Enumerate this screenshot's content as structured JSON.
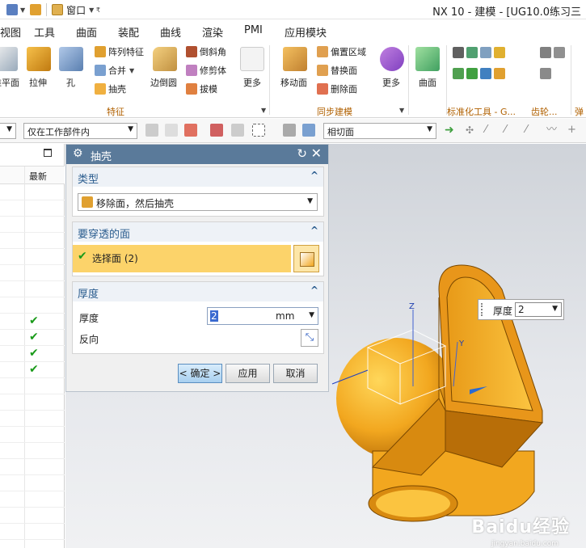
{
  "titlebar": {
    "window_menu": "窗口",
    "app_title": "NX 10 - 建模 - [UG10.0练习三"
  },
  "menubar": [
    "视图",
    "工具",
    "曲面",
    "装配",
    "曲线",
    "渲染",
    "PMI",
    "应用模块"
  ],
  "ribbon": {
    "feature": {
      "datum_plane": "基准平面",
      "extrude": "拉伸",
      "hole": "孔",
      "pattern_feature": "阵列特征",
      "unite": "合并",
      "shell": "抽壳",
      "edge_blend": "边倒圆",
      "chamfer": "倒斜角",
      "trim_body": "修剪体",
      "draft": "拔模",
      "more": "更多",
      "group_label": "特征"
    },
    "sync": {
      "move_face": "移动面",
      "offset_region": "偏置区域",
      "replace_face": "替换面",
      "delete_face": "删除面",
      "more": "更多",
      "group_label": "同步建模"
    },
    "surface": {
      "surface": "曲面",
      "group_label": "标准化工具 - G...",
      "gear_label": "齿轮...",
      "spring_label": "弹"
    }
  },
  "toolbar": {
    "filter_value": "仅在工作部件内",
    "face_rule_value": "相切面"
  },
  "left_panel": {
    "latest_header": "最新",
    "checked_rows": [
      8,
      9,
      10,
      11
    ]
  },
  "dialog": {
    "title": "抽壳",
    "type_section": {
      "title": "类型",
      "value": "移除面，然后抽壳"
    },
    "face_section": {
      "title": "要穿透的面",
      "select_label": "选择面 (2)"
    },
    "thickness_section": {
      "title": "厚度",
      "thickness_label": "厚度",
      "thickness_value": "2",
      "unit": "mm",
      "reverse_label": "反向"
    },
    "ok_label": "< 确定 >",
    "apply_label": "应用",
    "cancel_label": "取消"
  },
  "viewport": {
    "float_label": "厚度",
    "float_value": "2",
    "axis_z": "Z",
    "axis_y": "Y",
    "watermark": "Baidu经验",
    "watermark_url": "jingyan.baidu.com"
  },
  "colors": {
    "model_orange": "#f2a71f",
    "title_blue": "#5a7a9a",
    "select_yellow": "#fcd36a",
    "check_green": "#1a9a1a"
  }
}
